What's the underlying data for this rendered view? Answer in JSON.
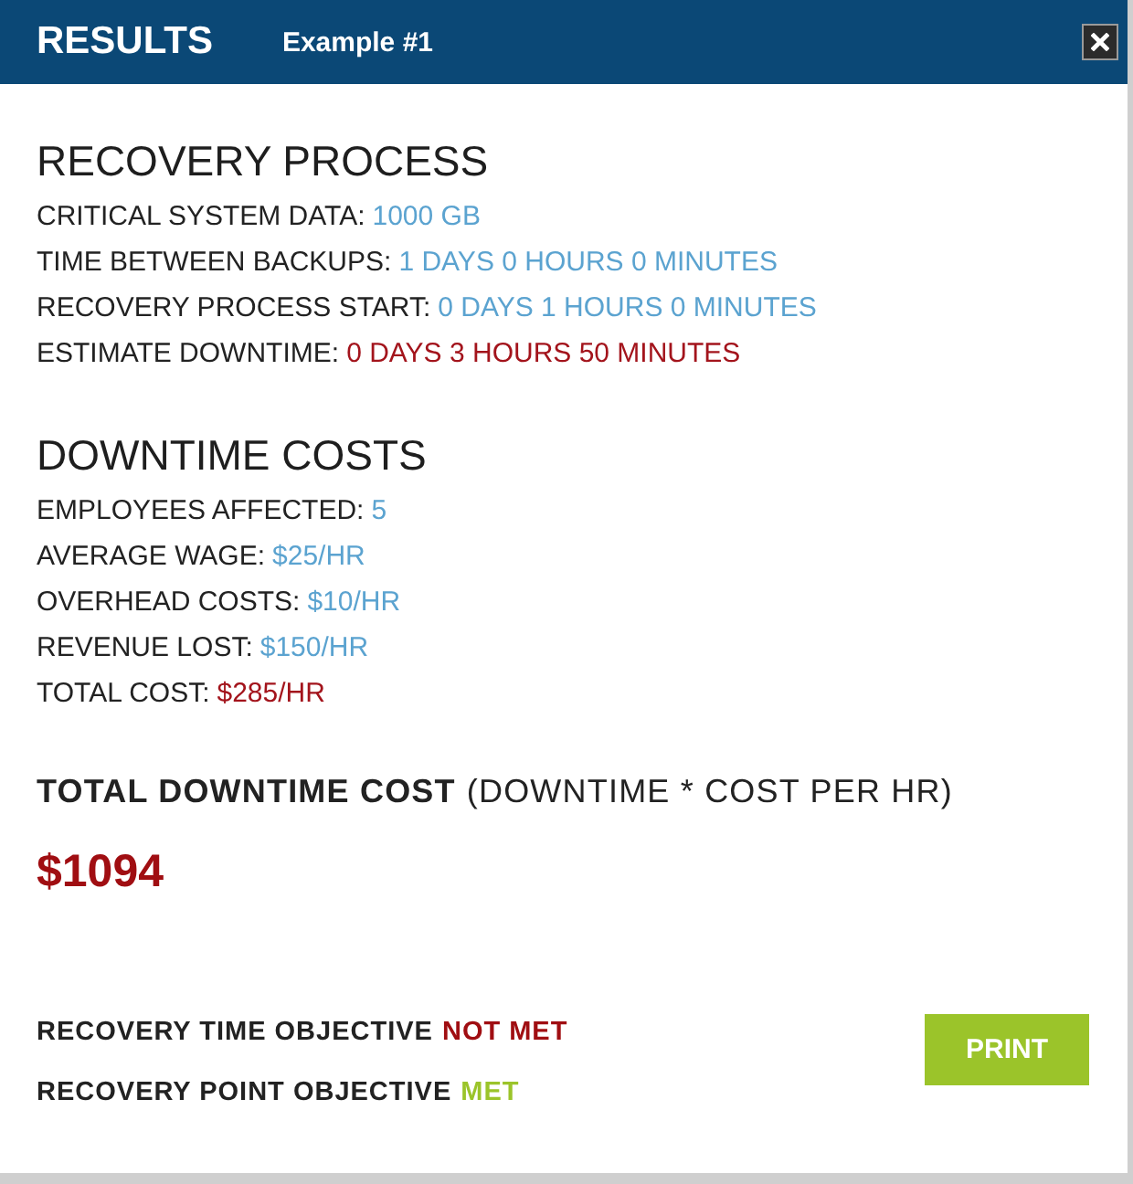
{
  "header": {
    "title": "RESULTS",
    "subtitle": "Example #1"
  },
  "sections": [
    {
      "heading": "RECOVERY PROCESS",
      "rows": [
        {
          "label": "CRITICAL SYSTEM DATA:",
          "value": "1000 GB",
          "color": "#5ba3d0"
        },
        {
          "label": "TIME BETWEEN BACKUPS:",
          "value": "1 DAYS 0 HOURS 0 MINUTES",
          "color": "#5ba3d0"
        },
        {
          "label": "RECOVERY PROCESS START:",
          "value": "0 DAYS 1 HOURS 0 MINUTES",
          "color": "#5ba3d0"
        },
        {
          "label": "ESTIMATE DOWNTIME:",
          "value": "0 DAYS 3 HOURS 50 MINUTES",
          "color": "#a3141c"
        }
      ]
    },
    {
      "heading": "DOWNTIME COSTS",
      "rows": [
        {
          "label": "EMPLOYEES AFFECTED:",
          "value": "5",
          "color": "#5ba3d0"
        },
        {
          "label": "AVERAGE WAGE:",
          "value": "$25/HR",
          "color": "#5ba3d0"
        },
        {
          "label": "OVERHEAD COSTS:",
          "value": "$10/HR",
          "color": "#5ba3d0"
        },
        {
          "label": "REVENUE LOST:",
          "value": "$150/HR",
          "color": "#5ba3d0"
        },
        {
          "label": "TOTAL COST:",
          "value": "$285/HR",
          "color": "#a3141c"
        }
      ]
    }
  ],
  "total": {
    "label": "TOTAL DOWNTIME COST",
    "formula": "(DOWNTIME * COST PER HR)",
    "amount": "$1094"
  },
  "objectives": [
    {
      "label": "RECOVERY TIME OBJECTIVE",
      "status": "NOT MET",
      "met": false
    },
    {
      "label": "RECOVERY POINT OBJECTIVE",
      "status": "MET",
      "met": true
    }
  ],
  "print_button": {
    "label": "PRINT"
  }
}
